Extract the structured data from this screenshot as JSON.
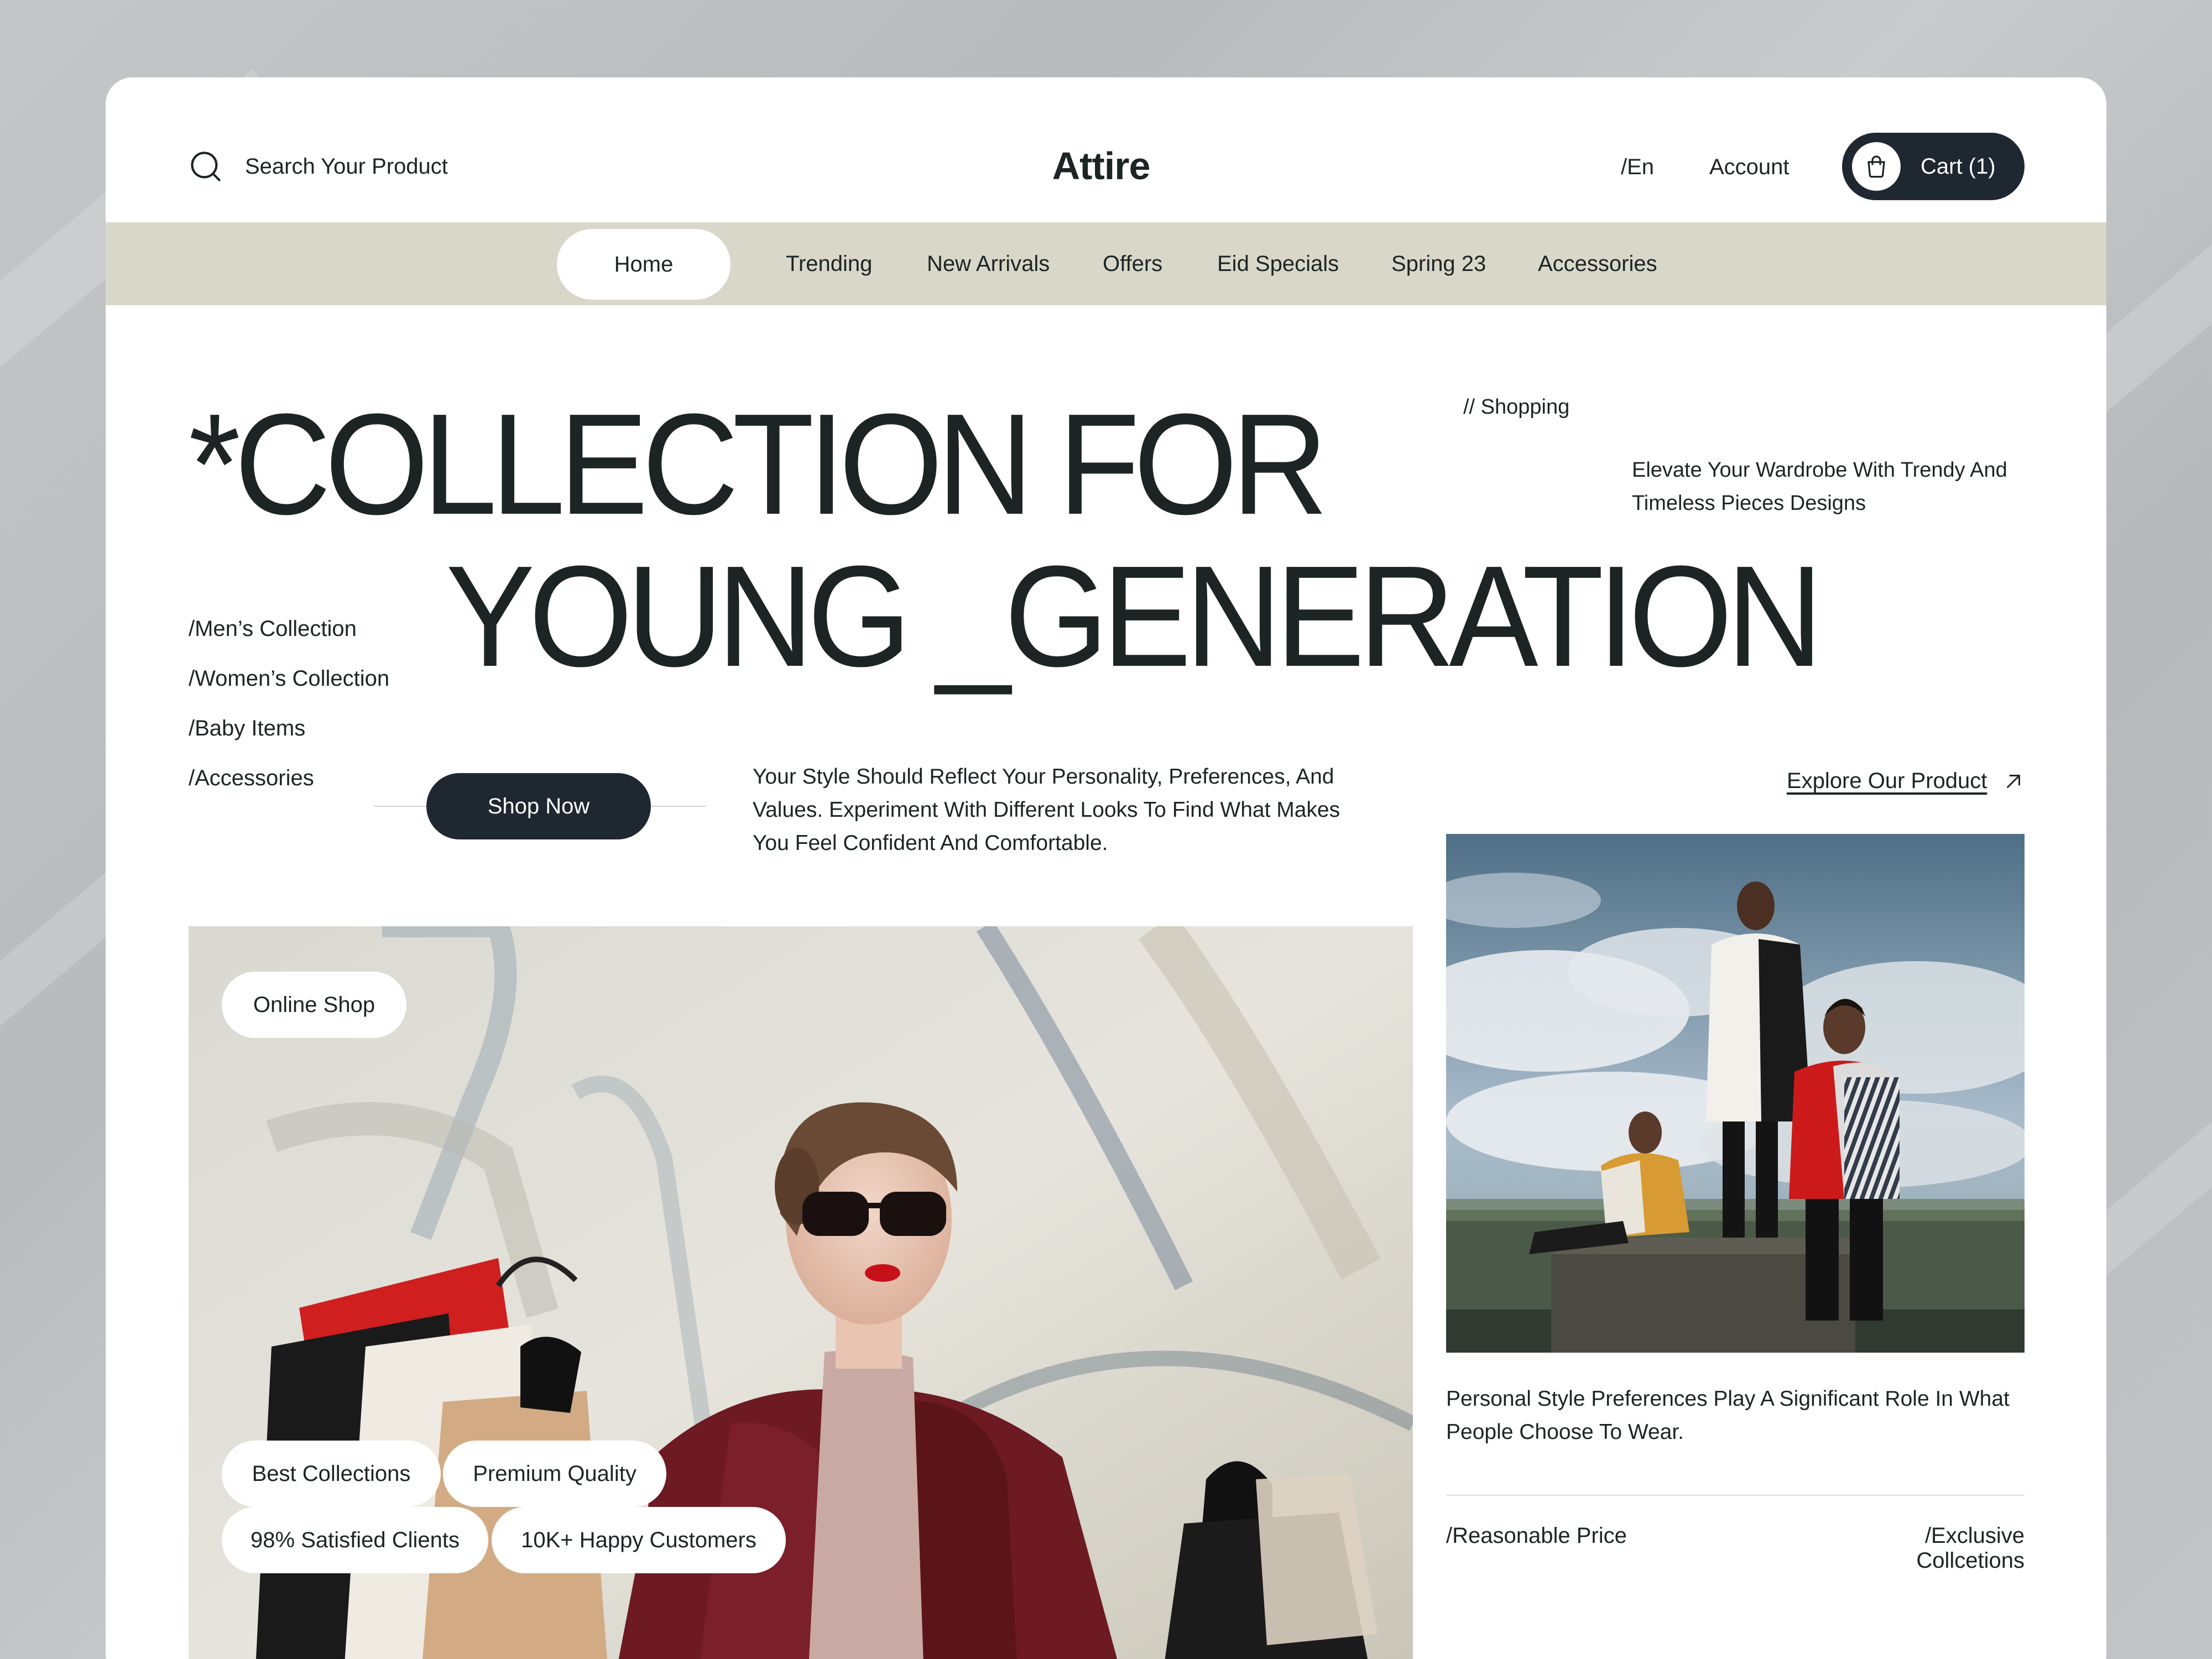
{
  "header": {
    "search_placeholder": "Search Your Product",
    "brand": "Attire",
    "language": "/En",
    "account": "Account",
    "cart": "Cart (1)"
  },
  "nav": {
    "tabs": [
      "Home",
      "Trending",
      "New Arrivals",
      "Offers",
      "Eid Specials",
      "Spring 23",
      "Accessories"
    ],
    "active": "Home"
  },
  "hero": {
    "headline_line1": "*COLLECTION FOR",
    "headline_line2": "YOUNG _GENERATION",
    "shopping_tag": "// Shopping",
    "elevate_text": "Elevate Your Wardrobe With Trendy And Timeless Pieces Designs",
    "collections": [
      "/Men’s Collection",
      "/Women’s Collection",
      "/Baby Items",
      "/Accessories"
    ],
    "shop_now": "Shop Now",
    "style_text": "Your Style Should Reflect Your Personality, Preferences, And Values. Experiment With Different Looks To Find What Makes You Feel Confident And Comfortable.",
    "explore": "Explore Our Product"
  },
  "main_photo": {
    "badge": "Online Shop",
    "pills": [
      "Best Collections",
      "Premium Quality",
      "98% Satisfied Clients",
      "10K+ Happy Customers"
    ]
  },
  "side": {
    "personal_text": "Personal Style Preferences Play A Significant Role In What People Choose To Wear.",
    "reasonable": "/Reasonable Price",
    "exclusive": "/Exclusive Collcetions"
  },
  "colors": {
    "dark": "#1f2730",
    "nav_bg": "#d8d7c9",
    "text": "#1d2424",
    "page_bg": "#c0c2c4"
  }
}
